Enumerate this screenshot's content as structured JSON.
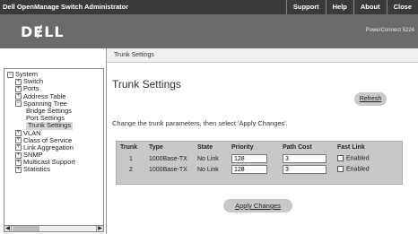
{
  "header": {
    "app_title": "Dell OpenManage Switch Administrator",
    "nav": [
      "Support",
      "Help",
      "About",
      "Close"
    ],
    "logo": "DɆLL",
    "model": "PowerConnect 5224"
  },
  "breadcrumb": "Trunk Settings",
  "tree": [
    {
      "label": "System",
      "expander": "−",
      "level": 0
    },
    {
      "label": "Switch",
      "expander": "+",
      "level": 1
    },
    {
      "label": "Ports",
      "expander": "+",
      "level": 1
    },
    {
      "label": "Address Table",
      "expander": "+",
      "level": 1
    },
    {
      "label": "Spanning Tree",
      "expander": "−",
      "level": 1
    },
    {
      "label": "Bridge Settings",
      "expander": "",
      "level": 2
    },
    {
      "label": "Port Settings",
      "expander": "",
      "level": 2
    },
    {
      "label": "Trunk Settings",
      "expander": "",
      "level": 2
    },
    {
      "label": "VLAN",
      "expander": "+",
      "level": 1
    },
    {
      "label": "Class of Service",
      "expander": "+",
      "level": 1
    },
    {
      "label": "Link Aggregation",
      "expander": "+",
      "level": 1
    },
    {
      "label": "SNMP",
      "expander": "+",
      "level": 1
    },
    {
      "label": "Multicast Support",
      "expander": "+",
      "level": 1
    },
    {
      "label": "Statistics",
      "expander": "+",
      "level": 1
    }
  ],
  "main": {
    "title": "Trunk Settings",
    "refresh_label": "Refresh",
    "instructions": "Change the trunk parameters, then select 'Apply Changes'.",
    "columns": [
      "Trunk",
      "Type",
      "State",
      "Priority",
      "Path Cost",
      "Fast Link"
    ],
    "rows": [
      {
        "trunk": "1",
        "type": "1000Base-TX",
        "state": "No Link",
        "priority": "128",
        "path_cost": "3",
        "fast_link": "Enabled",
        "checked": false
      },
      {
        "trunk": "2",
        "type": "1000Base-TX",
        "state": "No Link",
        "priority": "128",
        "path_cost": "3",
        "fast_link": "Enabled",
        "checked": false
      }
    ],
    "apply_label": "Apply Changes"
  }
}
